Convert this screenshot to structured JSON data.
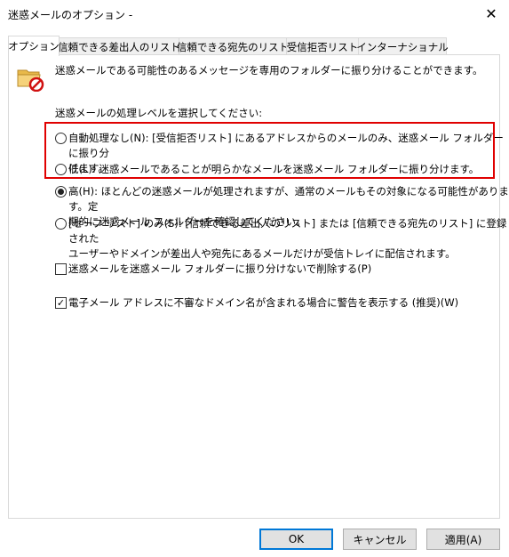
{
  "window": {
    "title": "迷惑メールのオプション -",
    "close_glyph": "✕"
  },
  "tabs": [
    {
      "label": "オプション",
      "active": true
    },
    {
      "label": "信頼できる差出人のリスト",
      "active": false
    },
    {
      "label": "信頼できる宛先のリスト",
      "active": false
    },
    {
      "label": "受信拒否リスト",
      "active": false
    },
    {
      "label": "インターナショナル",
      "active": false
    }
  ],
  "options": {
    "description": "迷惑メールである可能性のあるメッセージを専用のフォルダーに振り分けることができます。",
    "level_heading": "迷惑メールの処理レベルを選択してください:",
    "levels": [
      {
        "line1": "自動処理なし(N): [受信拒否リスト] にあるアドレスからのメールのみ、迷惑メール フォルダーに振り分",
        "line2": "けます。",
        "checked": false
      },
      {
        "line1": "低(L): 迷惑メールであることが明らかなメールを迷惑メール フォルダーに振り分けます。",
        "line2": "",
        "checked": false
      },
      {
        "line1": "高(H): ほとんどの迷惑メールが処理されますが、通常のメールもその対象になる可能性があります。定",
        "line2": "期的に迷惑メール フォルダーを確認してください。",
        "checked": true
      },
      {
        "line1": "[セーフ リスト] のみ(S): [信頼できる差出人のリスト] または [信頼できる宛先のリスト] に登録された",
        "line2": "ユーザーやドメインが差出人や宛先にあるメールだけが受信トレイに配信されます。",
        "checked": false
      }
    ],
    "delete_checkbox": {
      "label": "迷惑メールを迷惑メール フォルダーに振り分けないで削除する(P)",
      "checked": false
    },
    "warn_checkbox": {
      "label": "電子メール アドレスに不審なドメイン名が含まれる場合に警告を表示する (推奨)(W)",
      "checked": true,
      "check_glyph": "✓"
    }
  },
  "footer": {
    "ok": "OK",
    "cancel": "キャンセル",
    "apply": "適用(A)"
  },
  "colors": {
    "highlight": "#e00000",
    "default_button_border": "#0078d7"
  }
}
